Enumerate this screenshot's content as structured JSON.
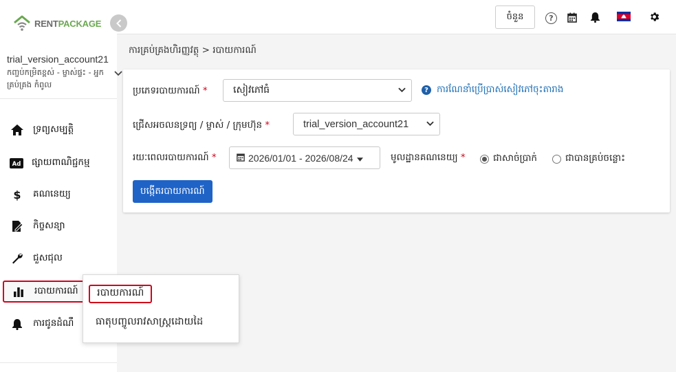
{
  "app": {
    "logo_part1": "RENT",
    "logo_part2": "PACKAGE",
    "brand_color": "#6aa84f"
  },
  "account": {
    "name": "trial_version_account21",
    "roles": "កញ្ចប់កម្រិតខ្ពស់ - ម្ចាស់ផ្ទះ - អ្នកគ្រប់គ្រង កំពូល"
  },
  "sidebar": {
    "items": [
      {
        "label": "ទ្រព្យសម្បត្តិ",
        "icon": "home-icon"
      },
      {
        "label": "ផ្សាយពាណិជ្ជកម្ម",
        "icon": "ad-icon"
      },
      {
        "label": "គណនេយ្យ",
        "icon": "dollar-icon"
      },
      {
        "label": "កិច្ចសន្យា",
        "icon": "contract-icon"
      },
      {
        "label": "ជួសជុល",
        "icon": "wrench-icon"
      },
      {
        "label": "របាយការណ៍",
        "icon": "bar-chart-icon",
        "active": true
      },
      {
        "label": "ការជូនដំណឹ",
        "icon": "bell-icon"
      }
    ]
  },
  "topbar": {
    "button_label": "ចំនួន",
    "help_label": "?",
    "language": "Khmer"
  },
  "breadcrumb": "ការគ្រប់គ្រងហិរញ្ញវត្ថុ > របាយការណ៍",
  "form": {
    "report_type": {
      "label": "ប្រភេទរបាយការណ៍",
      "value": "សៀវភៅធំ"
    },
    "info_link": "ការណែនាំប្រើប្រាស់សៀវភៅចុះតារាង",
    "entity": {
      "label": "ជ្រើសអចលនទ្រព្យ / ម្ចាស់ / ក្រុមហ៊ុន",
      "value": "trial_version_account21"
    },
    "period": {
      "label": "រយៈពេលរបាយការណ៍",
      "value": "2026/01/01 - 2026/08/24"
    },
    "basis": {
      "label": "មូលដ្ឋានគណនេយ្យ",
      "options": [
        "ជាសាច់ប្រាក់",
        "ជាបានគ្រប់ចន្លោះ"
      ],
      "selected": "ជាសាច់ប្រាក់"
    },
    "generate_button": "បង្កើតរបាយការណ៍"
  },
  "popup": {
    "items": [
      "របាយការណ៍",
      "ធាតុបញ្ចូលរាវសាស្ត្រដោយដៃ"
    ]
  }
}
